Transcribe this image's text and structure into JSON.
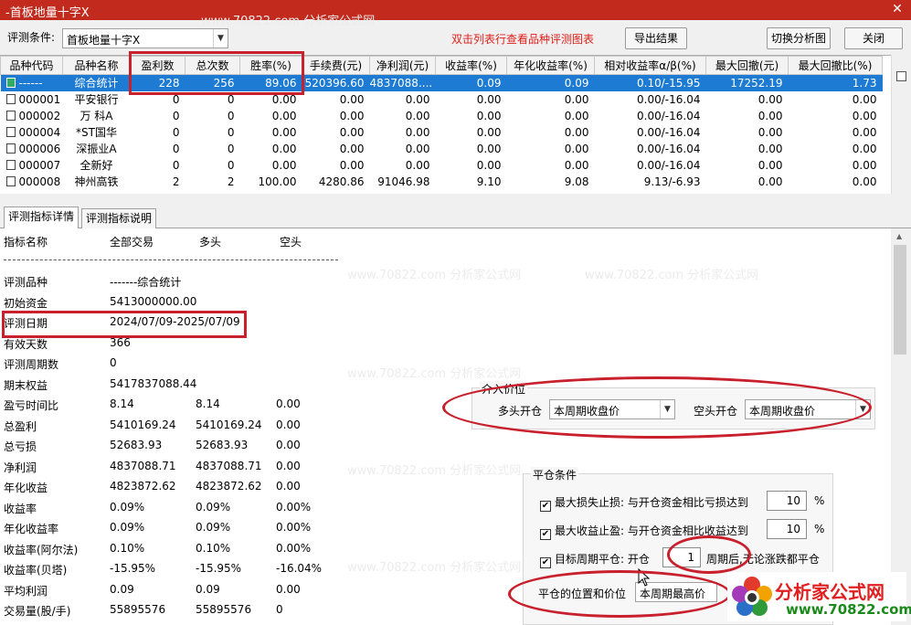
{
  "window": {
    "title": "-首板地量十字X",
    "close_glyph": "✕"
  },
  "toolbar": {
    "condition_label": "评测条件:",
    "condition_value": "首板地量十字X",
    "hint": "双击列表行查看品种评测图表",
    "export_label": "导出结果",
    "switch_chart_label": "切换分析图",
    "close_label": "关闭"
  },
  "table": {
    "headers": [
      "品种代码",
      "品种名称",
      "盈利数",
      "总次数",
      "胜率(%)",
      "手续费(元)",
      "净利润(元)",
      "收益率(%)",
      "年化收益率(%)",
      "相对收益率α/β(%)",
      "最大回撤(元)",
      "最大回撤比(%)"
    ],
    "rows": [
      [
        "------",
        "综合统计",
        "228",
        "256",
        "89.06",
        "520396.60",
        "4837088....",
        "0.09",
        "0.09",
        "0.10/-15.95",
        "17252.19",
        "1.73"
      ],
      [
        "000001",
        "平安银行",
        "0",
        "0",
        "0.00",
        "0.00",
        "0.00",
        "0.00",
        "0.00",
        "0.00/-16.04",
        "0.00",
        "0.00"
      ],
      [
        "000002",
        "万 科A",
        "0",
        "0",
        "0.00",
        "0.00",
        "0.00",
        "0.00",
        "0.00",
        "0.00/-16.04",
        "0.00",
        "0.00"
      ],
      [
        "000004",
        "*ST国华",
        "0",
        "0",
        "0.00",
        "0.00",
        "0.00",
        "0.00",
        "0.00",
        "0.00/-16.04",
        "0.00",
        "0.00"
      ],
      [
        "000006",
        "深振业A",
        "0",
        "0",
        "0.00",
        "0.00",
        "0.00",
        "0.00",
        "0.00",
        "0.00/-16.04",
        "0.00",
        "0.00"
      ],
      [
        "000007",
        "全新好",
        "0",
        "0",
        "0.00",
        "0.00",
        "0.00",
        "0.00",
        "0.00",
        "0.00/-16.04",
        "0.00",
        "0.00"
      ],
      [
        "000008",
        "神州高铁",
        "2",
        "2",
        "100.00",
        "4280.86",
        "91046.98",
        "9.10",
        "9.08",
        "9.13/-6.93",
        "0.00",
        "0.00"
      ]
    ]
  },
  "tabs": [
    "评测指标详情",
    "评测指标说明"
  ],
  "detail": {
    "header": [
      "指标名称",
      "全部交易",
      "多头",
      "空头"
    ],
    "rows": [
      {
        "name": "评测品种",
        "all": "-------综合统计",
        "long": "",
        "short": ""
      },
      {
        "name": "初始资金",
        "all": "5413000000.00",
        "long": "",
        "short": ""
      },
      {
        "name": "评测日期",
        "all": "2024/07/09-2025/07/09",
        "long": "",
        "short": ""
      },
      {
        "name": "有效天数",
        "all": "366",
        "long": "",
        "short": ""
      },
      {
        "name": "评测周期数",
        "all": "0",
        "long": "",
        "short": ""
      },
      {
        "name": "期末权益",
        "all": "5417837088.44",
        "long": "",
        "short": ""
      },
      {
        "name": "盈亏时间比",
        "all": "8.14",
        "long": "8.14",
        "short": "0.00"
      },
      {
        "name": "总盈利",
        "all": "5410169.24",
        "long": "5410169.24",
        "short": "0.00"
      },
      {
        "name": "总亏损",
        "all": "52683.93",
        "long": "52683.93",
        "short": "0.00"
      },
      {
        "name": "净利润",
        "all": "4837088.71",
        "long": "4837088.71",
        "short": "0.00"
      },
      {
        "name": "年化收益",
        "all": "4823872.62",
        "long": "4823872.62",
        "short": "0.00"
      },
      {
        "name": "收益率",
        "all": "0.09%",
        "long": "0.09%",
        "short": "0.00%"
      },
      {
        "name": "年化收益率",
        "all": "0.09%",
        "long": "0.09%",
        "short": "0.00%"
      },
      {
        "name": "收益率(阿尔法)",
        "all": "0.10%",
        "long": "0.10%",
        "short": "0.00%"
      },
      {
        "name": "收益率(贝塔)",
        "all": "-15.95%",
        "long": "-15.95%",
        "short": "-16.04%"
      },
      {
        "name": "平均利润",
        "all": "0.09",
        "long": "0.09",
        "short": "0.00"
      },
      {
        "name": "交易量(股/手)",
        "all": "55895576",
        "long": "55895576",
        "short": "0"
      }
    ]
  },
  "entry": {
    "group_title": "介入价位",
    "long_label": "多头开仓",
    "long_value": "本周期收盘价",
    "short_label": "空头开仓",
    "short_value": "本周期收盘价"
  },
  "exit": {
    "group_title": "平仓条件",
    "stop_loss_label": "最大损失止损: 与开仓资金相比亏损达到",
    "stop_loss_value": "10",
    "take_profit_label": "最大收益止盈: 与开仓资金相比收益达到",
    "take_profit_value": "10",
    "pct": "%",
    "period_label": "目标周期平仓: 开仓",
    "period_value": "1",
    "period_suffix": "周期后,无论涨跌都平仓",
    "position_label": "平仓的位置和价位",
    "position_value": "本周期最高价"
  },
  "watermark": "www.70822.com 分析家公式网",
  "logo": {
    "name": "分析家公式网",
    "url": "www.70822.com"
  },
  "colors": {
    "title_bar": "#c12a1d",
    "selection": "#1d7bd3",
    "annotation": "#c8202c"
  }
}
